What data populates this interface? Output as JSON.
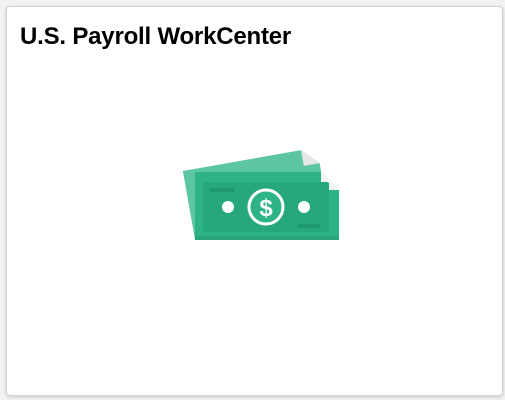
{
  "tile": {
    "title": "U.S. Payroll WorkCenter",
    "icon": "money-bills-icon"
  },
  "colors": {
    "bill_front": "#2db385",
    "bill_back": "#5cc6a0",
    "bill_dark": "#1f9a70",
    "fold": "#e6e6e6",
    "title_text": "#000000",
    "tile_background": "#ffffff"
  }
}
